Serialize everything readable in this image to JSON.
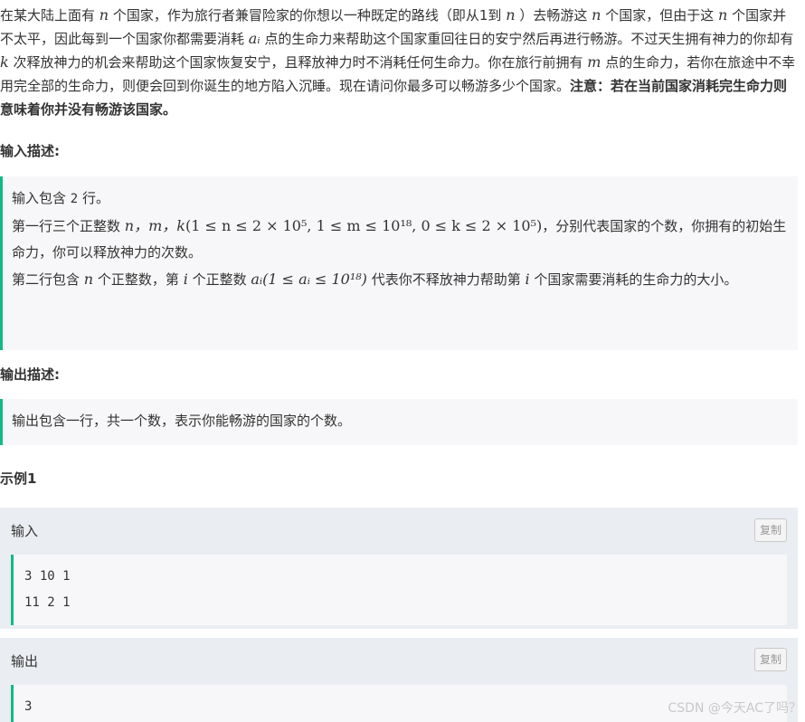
{
  "intro": {
    "p1": "在某大陆上面有",
    "var_n": "n",
    "p2": "个国家，作为旅行者兼冒险家的你想以一种既定的路线（即从1到",
    "p3": "）去畅游这",
    "p4": "个国家，但由于这",
    "p5": "个国家并不太平，因此每到一个国家你都需要消耗",
    "var_ai": "aᵢ",
    "p6": "点的生命力来帮助这个国家重回往日的安宁然后再进行畅游。不过天生拥有神力的你却有",
    "var_k": "k",
    "p7": "次释放神力的机会来帮助这个国家恢复安宁，且释放神力时不消耗任何生命力。你在旅行前拥有",
    "var_m": "m",
    "p8": "点的生命力，若你在旅途中不幸用完全部的生命力，则便会回到你诞生的地方陷入沉睡。现在请问你最多可以畅游多少个国家。",
    "note": "注意：若在当前国家消耗完生命力则意味着你并没有畅游该国家。"
  },
  "input_heading": "输入描述:",
  "input_desc": {
    "l1a": "输入包含",
    "l1num": "2",
    "l1b": "行。",
    "l2a": "第一行三个正整数",
    "l2vars": "n，m，k",
    "l2cons": "(1 ≤ n ≤ 2 × 10⁵, 1 ≤ m ≤ 10¹⁸, 0 ≤ k ≤ 2 × 10⁵)",
    "l2b": "，分别代表国家的个数，你拥有的初始生命力，你可以释放神力的次数。",
    "l3a": "第二行包含",
    "l3n": "n",
    "l3b": "个正整数，第",
    "l3i": "i",
    "l3c": "个正整数",
    "l3ai": "aᵢ(1 ≤ aᵢ ≤ 10¹⁸)",
    "l3d": "代表你不释放神力帮助第",
    "l3i2": "i",
    "l3e": "个国家需要消耗的生命力的大小。"
  },
  "output_heading": "输出描述:",
  "output_desc": "输出包含一行，共一个数，表示你能畅游的国家的个数。",
  "example_heading": "示例1",
  "sample_input": {
    "title": "输入",
    "copy": "复制",
    "lines": [
      "3 10 1",
      "11 2 1"
    ]
  },
  "sample_output": {
    "title": "输出",
    "copy": "复制",
    "lines": [
      "3"
    ]
  },
  "watermark": "CSDN @今天AC了吗？"
}
